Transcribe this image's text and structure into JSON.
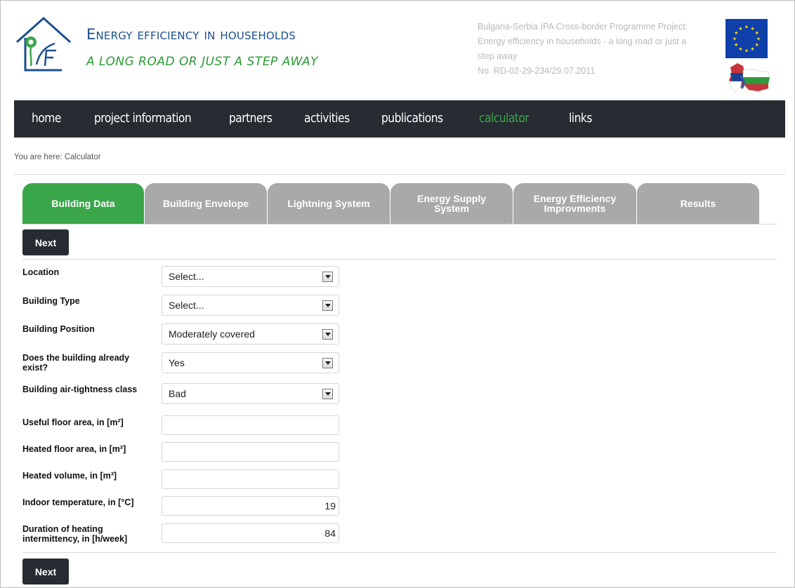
{
  "header": {
    "title": "Energy efficiency in households",
    "subtitle": "A LONG ROAD OR JUST A STEP AWAY",
    "project_line1": "Bulgaria-Serbia IPA Cross-border Programme Project:",
    "project_line2": "Energy efficiency in households - a long road or just a",
    "project_line3": "step away",
    "project_line4": "No. RD-02-29-234/29.07.2011"
  },
  "nav": {
    "items": [
      "home",
      "project information",
      "partners",
      "activities",
      "publications",
      "calculator",
      "links"
    ],
    "active": "calculator"
  },
  "breadcrumb": "You are here: Calculator",
  "tabs": [
    {
      "label": "Building Data",
      "active": true
    },
    {
      "label": "Building Envelope",
      "active": false
    },
    {
      "label": "Lightning System",
      "active": false
    },
    {
      "label": "Energy Supply\nSystem",
      "active": false
    },
    {
      "label": "Energy Efficiency\nImprovments",
      "active": false
    },
    {
      "label": "Results",
      "active": false
    }
  ],
  "buttons": {
    "next_top": "Next",
    "next_bottom": "Next"
  },
  "form": {
    "location": {
      "label": "Location",
      "value": "Select..."
    },
    "building_type": {
      "label": "Building Type",
      "value": "Select..."
    },
    "building_position": {
      "label": "Building Position",
      "value": "Moderately covered"
    },
    "already_exist": {
      "label": "Does the building already exist?",
      "value": "Yes"
    },
    "air_tightness": {
      "label": "Building air-tightness class",
      "value": "Bad"
    },
    "useful_floor_area": {
      "label": "Useful floor area, in [m²]",
      "value": ""
    },
    "heated_floor_area": {
      "label": "Heated floor area, in [m²]",
      "value": ""
    },
    "heated_volume": {
      "label": "Heated volume, in [m³]",
      "value": ""
    },
    "indoor_temperature": {
      "label": "Indoor temperature, in [°C]",
      "value": "19"
    },
    "heating_intermittency": {
      "label": "Duration of heating intermittency, in [h/week]",
      "value": "84"
    }
  },
  "colors": {
    "nav_bg": "#262c31",
    "accent_green": "#3aa64a",
    "tab_inactive": "#a9a9a9",
    "title_blue": "#1a4f8f",
    "eu_blue": "#0f3fa8",
    "eu_star": "#ffdd00"
  },
  "icons": {
    "logo": "house-leaf-logo-icon",
    "flag": "eu-flag-icon",
    "map": "bulgaria-serbia-map-icon",
    "dropdown": "dropdown-arrow-icon"
  }
}
